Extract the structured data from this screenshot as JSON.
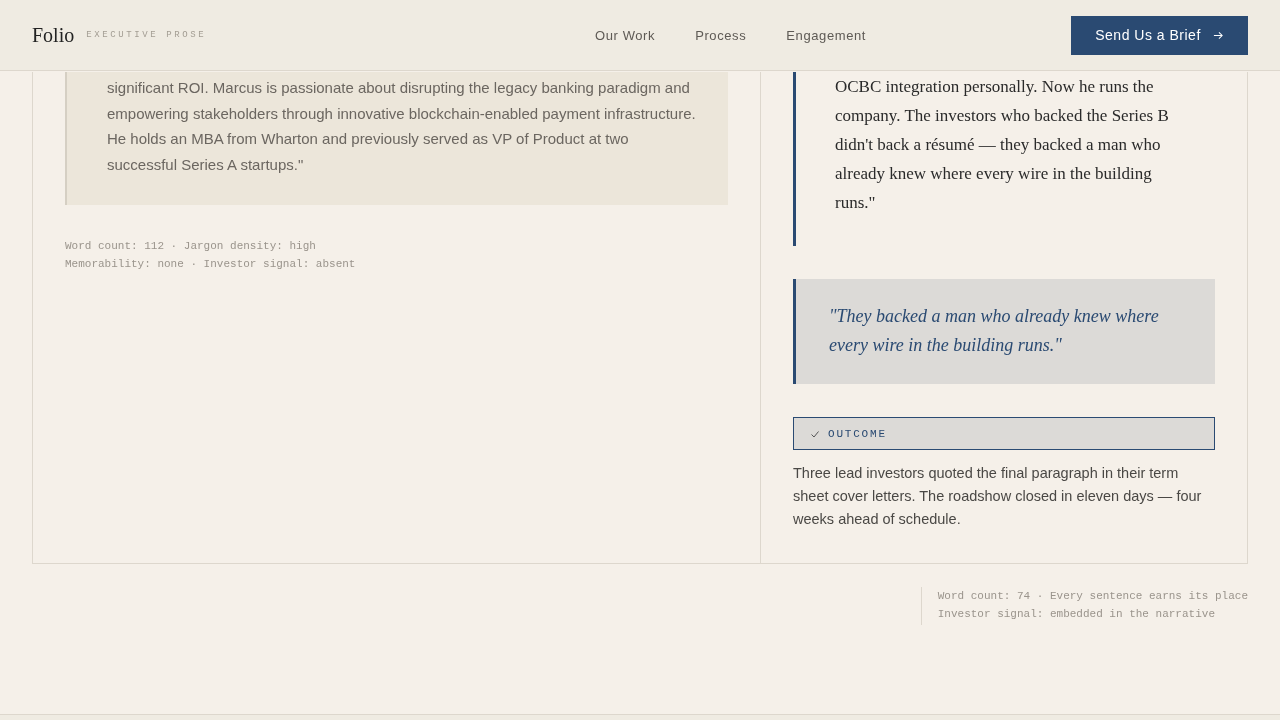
{
  "header": {
    "logo": "Folio",
    "tagline": "EXECUTIVE PROSE",
    "nav": [
      "Our Work",
      "Process",
      "Engagement"
    ],
    "cta": "Send Us a Brief"
  },
  "before": {
    "quote": "significant ROI. Marcus is passionate about disrupting the legacy banking paradigm and empowering stakeholders through innovative blockchain-enabled payment infrastructure. He holds an MBA from Wharton and previously served as VP of Product at two successful Series A startups.\"",
    "meta": [
      "Word count: 112 · Jargon density: high",
      "Memorability: none · Investor signal: absent"
    ]
  },
  "after": {
    "quote": "OCBC integration personally. Now he runs the company. The investors who backed the Series B didn't back a résumé — they backed a man who already knew where every wire in the building runs.\"",
    "pull_quote": "\"They backed a man who already knew where every wire in the building runs.\"",
    "outcome_label": "OUTCOME",
    "outcome_text": "Three lead investors quoted the final paragraph in their term sheet cover letters. The roadshow closed in eleven days — four weeks ahead of schedule."
  },
  "after_meta": [
    "Word count: 74 · Every sentence earns its place",
    "Investor signal: embedded in the narrative"
  ]
}
